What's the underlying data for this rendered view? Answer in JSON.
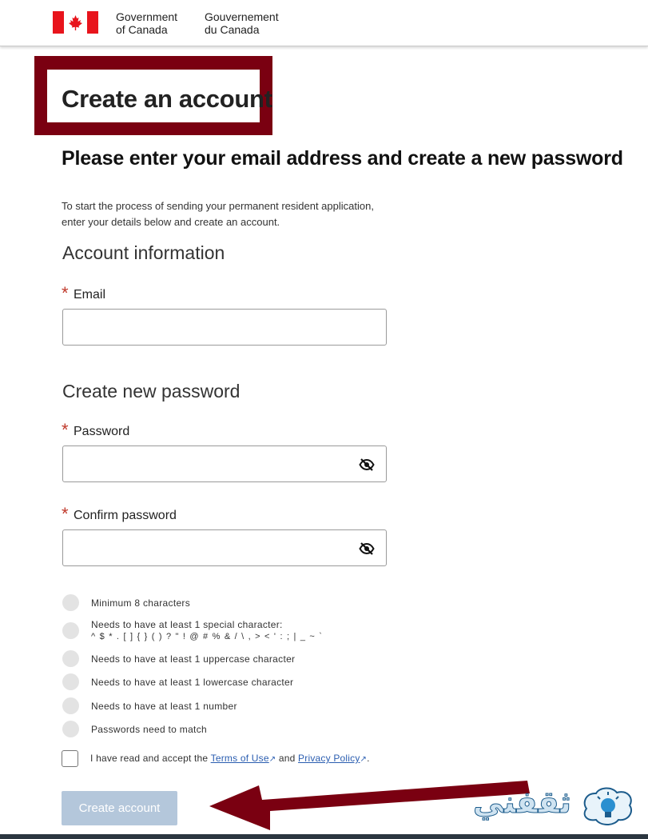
{
  "header": {
    "gov_en_line1": "Government",
    "gov_en_line2": "of Canada",
    "gov_fr_line1": "Gouvernement",
    "gov_fr_line2": "du Canada",
    "flag_icon": "canada-flag-icon"
  },
  "page": {
    "title": "Create an account",
    "subtitle": "Please enter your email address and create a new password",
    "intro_line1": "To start the process of sending your permanent resident application,",
    "intro_line2": "enter your details below and create an account."
  },
  "account_section": {
    "heading": "Account information",
    "email_label": "Email",
    "email_value": "",
    "required_marker": "*"
  },
  "password_section": {
    "heading": "Create new password",
    "password_label": "Password",
    "password_value": "",
    "confirm_label": "Confirm password",
    "confirm_value": "",
    "eye_icon": "eye-slash-icon"
  },
  "password_rules": [
    {
      "text": "Minimum 8 characters"
    },
    {
      "text": "Needs to have at least 1 special character:",
      "detail": "^ $ * . [ ] { } ( ) ? \" ! @ # % & / \\ , > < ' : ; | _ ~ `"
    },
    {
      "text": "Needs to have at least 1 uppercase character"
    },
    {
      "text": "Needs to have at least 1 lowercase character"
    },
    {
      "text": "Needs to have at least 1 number"
    },
    {
      "text": "Passwords need to match"
    }
  ],
  "terms": {
    "prefix": "I have read and accept the",
    "terms_link": "Terms of Use",
    "and_text": "and",
    "privacy_link": "Privacy Policy",
    "suffix": "."
  },
  "submit": {
    "label": "Create account"
  },
  "watermark": {
    "text": "ثقفني"
  },
  "colors": {
    "highlight": "#7a0011",
    "required": "#c0392b",
    "link": "#2a5db0",
    "button_disabled": "#b4c7db",
    "flag_red": "#e8141c"
  }
}
